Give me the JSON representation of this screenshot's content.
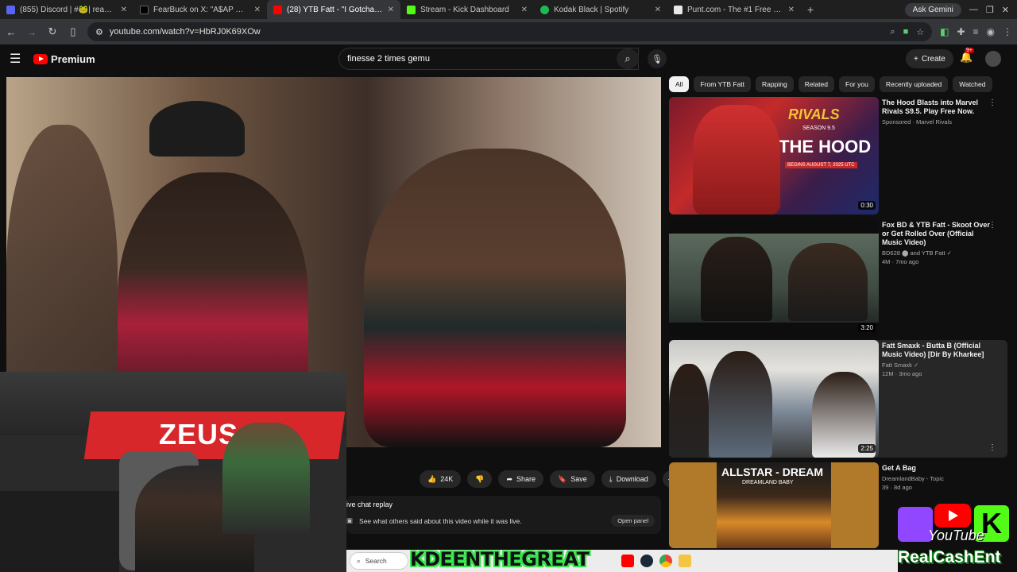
{
  "browser": {
    "tabs": [
      {
        "title": "(855) Discord | #🐸| reaction...",
        "favicon_color": "#5865f2",
        "active": false
      },
      {
        "title": "FearBuck on X: \"A$AP Rocky gi...",
        "favicon_color": "#000000",
        "active": false
      },
      {
        "title": "(28) YTB Fatt - \"I Gotcha Bi...",
        "favicon_color": "#ff0000",
        "active": true
      },
      {
        "title": "Stream - Kick Dashboard",
        "favicon_color": "#53fc18",
        "active": false
      },
      {
        "title": "Kodak Black | Spotify",
        "favicon_color": "#1db954",
        "active": false
      },
      {
        "title": "Punt.com - The #1 Free to Play...",
        "favicon_color": "#e8e8e8",
        "active": false
      }
    ],
    "ask_gemini": "Ask Gemini",
    "url": "youtube.com/watch?v=HbRJ0K69XOw"
  },
  "youtube": {
    "brand": "Premium",
    "search_value": "finesse 2 times gemu",
    "create_label": "Create",
    "notif_count": "9+",
    "chips": [
      "All",
      "From YTB Fatt",
      "Rapping",
      "Related",
      "For you",
      "Recently uploaded",
      "Watched"
    ],
    "actions": {
      "likes": "24K",
      "share": "Share",
      "save": "Save",
      "download": "Download"
    },
    "chat": {
      "title": "ive chat replay",
      "text": "See what others said about this video while it was live.",
      "button": "Open panel"
    },
    "related": [
      {
        "title": "The Hood Blasts into Marvel Rivals S9.5. Play Free Now.",
        "meta1": "Sponsored · Marvel Rivals",
        "meta2": "",
        "duration": "0:30"
      },
      {
        "title": "Fox BD & YTB Fatt - Skoot Over or Get Rolled Over (Official Music Video)",
        "meta1": "BD628 ⬤ and YTB Fatt ✓",
        "meta2": "4M · 7mo ago",
        "duration": "3:20"
      },
      {
        "title": "Fatt Smaxk - Butta B (Official Music Video) [Dir By Kharkee]",
        "meta1": "Fatt Smaxk ✓",
        "meta2": "12M · 3mo ago",
        "duration": "2:25"
      },
      {
        "title": "Get A Bag",
        "meta1": "DreamlandBaby - Topic",
        "meta2": "39 · 8d ago",
        "duration": ""
      }
    ],
    "thumb_text": {
      "rivals": "RIVALS",
      "season": "SEASON 9.5",
      "hood": "THE HOOD",
      "begins": "BEGINS AUGUST 7, 2025 UTC",
      "allstar": "ALLSTAR - DREAM",
      "dreamland": "DREAMLAND BABY"
    }
  },
  "taskbar": {
    "search": "Search"
  },
  "overlay": {
    "streamer": "KDEENTHEGREAT",
    "youtube_word": "YouTube",
    "brand_name": "RealCashEnt",
    "cam_brand": "ZEUS"
  }
}
